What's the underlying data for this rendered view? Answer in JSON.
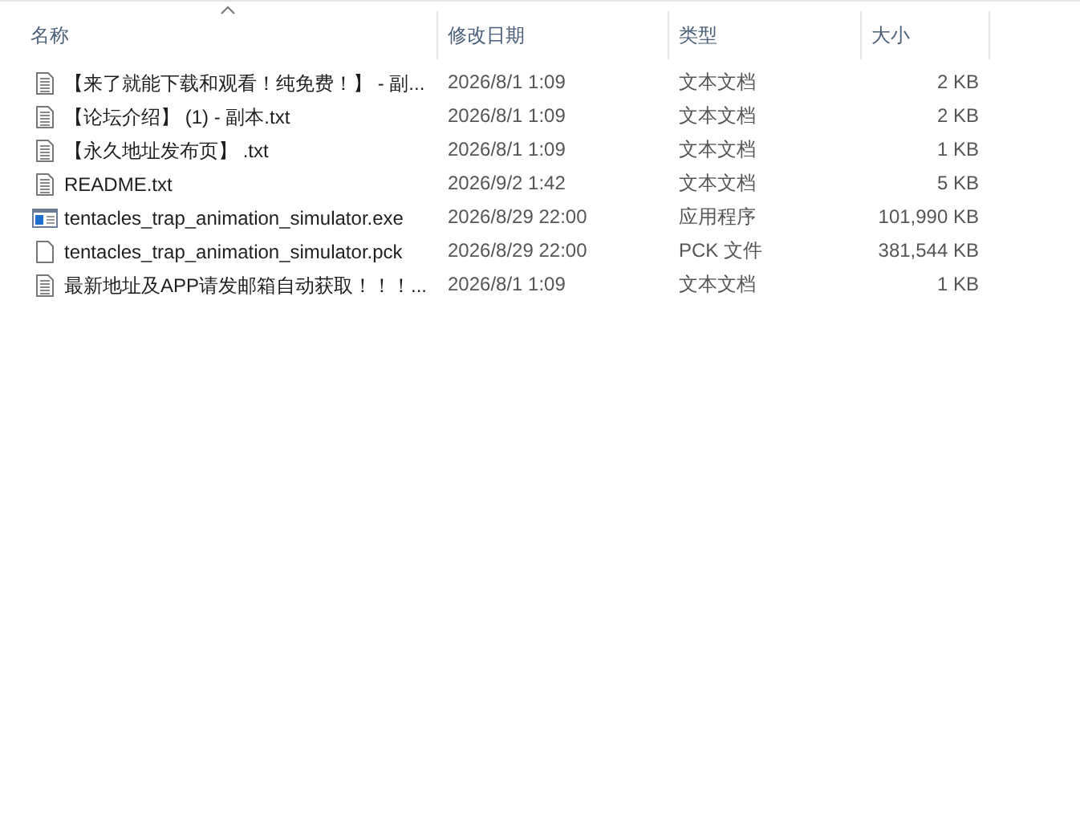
{
  "columns": [
    {
      "label": "名称",
      "sorted": true
    },
    {
      "label": "修改日期",
      "sorted": false
    },
    {
      "label": "类型",
      "sorted": false
    },
    {
      "label": "大小",
      "sorted": false
    }
  ],
  "files": [
    {
      "kind": "text",
      "name": "【来了就能下载和观看！纯免费！】 - 副...",
      "modified": "2026/8/1 1:09",
      "type": "文本文档",
      "size": "2 KB"
    },
    {
      "kind": "text",
      "name": "【论坛介绍】 (1) - 副本.txt",
      "modified": "2026/8/1 1:09",
      "type": "文本文档",
      "size": "2 KB"
    },
    {
      "kind": "text",
      "name": "【永久地址发布页】 .txt",
      "modified": "2026/8/1 1:09",
      "type": "文本文档",
      "size": "1 KB"
    },
    {
      "kind": "text",
      "name": "README.txt",
      "modified": "2026/9/2 1:42",
      "type": "文本文档",
      "size": "5 KB"
    },
    {
      "kind": "app",
      "name": "tentacles_trap_animation_simulator.exe",
      "modified": "2026/8/29 22:00",
      "type": "应用程序",
      "size": "101,990 KB"
    },
    {
      "kind": "blank",
      "name": "tentacles_trap_animation_simulator.pck",
      "modified": "2026/8/29 22:00",
      "type": "PCK 文件",
      "size": "381,544 KB"
    },
    {
      "kind": "text",
      "name": "最新地址及APP请发邮箱自动获取！！！...",
      "modified": "2026/8/1 1:09",
      "type": "文本文档",
      "size": "1 KB"
    }
  ]
}
